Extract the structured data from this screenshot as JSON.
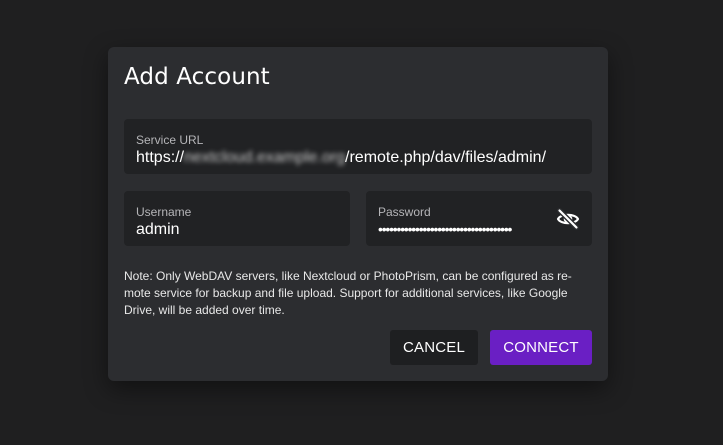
{
  "dialog": {
    "title": "Add Account",
    "service_url": {
      "label": "Service URL",
      "prefix": "https://",
      "host_obscured": "nextcloud.example.org",
      "suffix": "/remote.php/dav/files/admin/"
    },
    "username": {
      "label": "Username",
      "value": "admin"
    },
    "password": {
      "label": "Password",
      "masked_value": "••••••••••••••••••••••••••••••••••••"
    },
    "note": "Note: Only WebDAV servers, like Nextcloud or PhotoPrism, can be configured as re-mote service for backup and file upload. Support for additional services, like Google Drive, will be added over time.",
    "cancel_label": "Cancel",
    "connect_label": "Connect"
  },
  "icons": {
    "password_toggle": "eye-off-icon"
  },
  "colors": {
    "background": "#1f1f20",
    "dialog": "#2c2d30",
    "field": "#212224",
    "accent": "#6a1fc4"
  }
}
